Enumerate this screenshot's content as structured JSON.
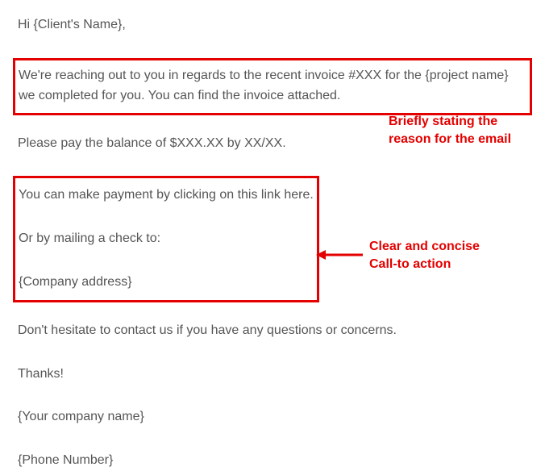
{
  "email": {
    "greeting": "Hi {Client's Name},",
    "intro": "We're reaching out to you in regards to the recent invoice #XXX for the {project name} we completed for you. You can find the invoice attached.",
    "balance": "Please pay the balance of $XXX.XX by XX/XX.",
    "payment_link": "You can make payment by clicking on this link here.",
    "mail_check": "Or by mailing a check to:",
    "company_address": "{Company address}",
    "contact_us": "Don't hesitate to contact us if you have any questions or concerns.",
    "thanks": "Thanks!",
    "company_name": "{Your company name}",
    "phone": "{Phone Number}"
  },
  "annotations": {
    "reason_line1": "Briefly stating the",
    "reason_line2": "reason for the email",
    "cta_line1": "Clear and concise",
    "cta_line2": "Call-to action"
  }
}
